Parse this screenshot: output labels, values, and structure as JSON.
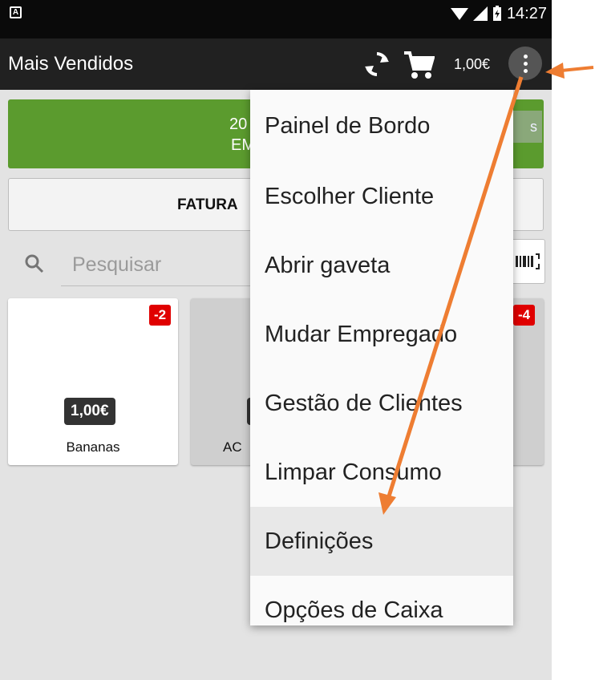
{
  "status_bar": {
    "notification_glyph": "A",
    "time": "14:27"
  },
  "toolbar": {
    "title": "Mais Vendidos",
    "cart_total": "1,00€"
  },
  "banner": {
    "line1": "20",
    "line2": "EM",
    "side_label": "s"
  },
  "document_tab": {
    "label": "FATURA"
  },
  "search": {
    "placeholder": "Pesquisar"
  },
  "products": [
    {
      "name": "Bananas",
      "price": "1,00€",
      "badge": "-2"
    },
    {
      "name": "AC",
      "price": "",
      "badge": ""
    },
    {
      "name": "",
      "price": "",
      "badge": "-4"
    }
  ],
  "menu": {
    "items": [
      "Painel de Bordo",
      "Escolher Cliente",
      "Abrir gaveta",
      "Mudar Empregado",
      "Gestão de Clientes",
      "Limpar Consumo",
      "Definições",
      "Opções de Caixa"
    ],
    "highlighted": "Definições"
  },
  "colors": {
    "toolbar": "#212121",
    "banner": "#5b9b2e",
    "badge": "#e00000",
    "annotation_arrow": "#ee7d32"
  }
}
